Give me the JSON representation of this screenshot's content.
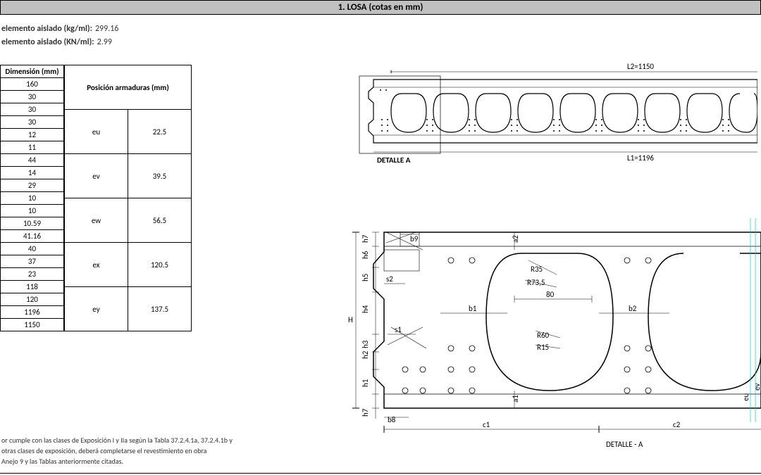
{
  "header": "1. LOSA (cotas en mm)",
  "info": {
    "r1_label": "elemento aislado (kg/ml):",
    "r1_val": "299.16",
    "r2_label": "elemento aislado (KN/ml):",
    "r2_val": "2.99"
  },
  "dim": {
    "header": "Dimensión (mm)",
    "values": [
      "160",
      "30",
      "30",
      "30",
      "12",
      "11",
      "44",
      "14",
      "29",
      "10",
      "10",
      "10.59",
      "41.16",
      "40",
      "37",
      "23",
      "118",
      "120",
      "1196",
      "1150"
    ]
  },
  "pos": {
    "header": "Posición armaduras (mm)",
    "rows": [
      {
        "k": "eu",
        "v": "22.5"
      },
      {
        "k": "ev",
        "v": "39.5"
      },
      {
        "k": "ew",
        "v": "56.5"
      },
      {
        "k": "ex",
        "v": "120.5"
      },
      {
        "k": "ey",
        "v": "137.5"
      }
    ]
  },
  "notes": {
    "l1": "or cumple con las clases de Exposición I y IIa según la Tabla 37.2.4.1a, 37.2.4.1b y",
    "l2": "otras clases de exposición, deberá completarse el revestimiento en obra",
    "l3": "Anejo 9 y las Tablas anteriormente citadas."
  },
  "diag": {
    "L2": "L2=1150",
    "L1": "L1=1196",
    "detalleA": "DETALLE A",
    "detalleA2": "DETALLE - A",
    "R35": "R35",
    "R73": "R73,5",
    "R60": "R60",
    "R15": "R15",
    "w80": "80",
    "H": "H",
    "b1": "b1",
    "b2": "b2",
    "a1": "a1",
    "a2": "a2",
    "c1": "c1",
    "c2": "c2",
    "s1": "s1",
    "s2": "s2",
    "h1": "h1",
    "h2": "h2",
    "h3": "h3",
    "h4": "h4",
    "h5": "h5",
    "h6": "h6",
    "h7": "h7",
    "h8": "b8",
    "h9": "b9",
    "eu": "eu",
    "ev": "ev"
  }
}
